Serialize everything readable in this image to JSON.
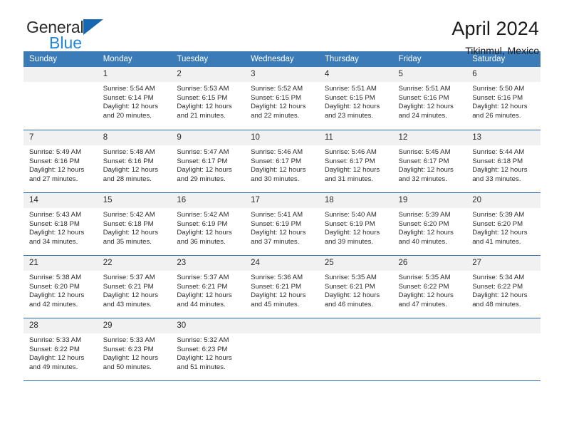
{
  "brand": {
    "name_part1": "General",
    "name_part2": "Blue",
    "triangle_color": "#1668b3",
    "blue_color": "#2287d8"
  },
  "header": {
    "title": "April 2024",
    "location": "Tikinmul, Mexico"
  },
  "theme": {
    "header_bg": "#3b7cb8",
    "daynum_bg": "#f1f1f1",
    "rule_color": "#2d6ca8",
    "text_color": "#2b2b2b"
  },
  "weekday_headers": [
    "Sunday",
    "Monday",
    "Tuesday",
    "Wednesday",
    "Thursday",
    "Friday",
    "Saturday"
  ],
  "labels": {
    "sunrise_prefix": "Sunrise: ",
    "sunset_prefix": "Sunset: ",
    "daylight_prefix": "Daylight: "
  },
  "weeks": [
    [
      {
        "day": "",
        "empty": true
      },
      {
        "day": "1",
        "sunrise": "Sunrise: 5:54 AM",
        "sunset": "Sunset: 6:14 PM",
        "daylight_l1": "Daylight: 12 hours",
        "daylight_l2": "and 20 minutes."
      },
      {
        "day": "2",
        "sunrise": "Sunrise: 5:53 AM",
        "sunset": "Sunset: 6:15 PM",
        "daylight_l1": "Daylight: 12 hours",
        "daylight_l2": "and 21 minutes."
      },
      {
        "day": "3",
        "sunrise": "Sunrise: 5:52 AM",
        "sunset": "Sunset: 6:15 PM",
        "daylight_l1": "Daylight: 12 hours",
        "daylight_l2": "and 22 minutes."
      },
      {
        "day": "4",
        "sunrise": "Sunrise: 5:51 AM",
        "sunset": "Sunset: 6:15 PM",
        "daylight_l1": "Daylight: 12 hours",
        "daylight_l2": "and 23 minutes."
      },
      {
        "day": "5",
        "sunrise": "Sunrise: 5:51 AM",
        "sunset": "Sunset: 6:16 PM",
        "daylight_l1": "Daylight: 12 hours",
        "daylight_l2": "and 24 minutes."
      },
      {
        "day": "6",
        "sunrise": "Sunrise: 5:50 AM",
        "sunset": "Sunset: 6:16 PM",
        "daylight_l1": "Daylight: 12 hours",
        "daylight_l2": "and 26 minutes."
      }
    ],
    [
      {
        "day": "7",
        "sunrise": "Sunrise: 5:49 AM",
        "sunset": "Sunset: 6:16 PM",
        "daylight_l1": "Daylight: 12 hours",
        "daylight_l2": "and 27 minutes."
      },
      {
        "day": "8",
        "sunrise": "Sunrise: 5:48 AM",
        "sunset": "Sunset: 6:16 PM",
        "daylight_l1": "Daylight: 12 hours",
        "daylight_l2": "and 28 minutes."
      },
      {
        "day": "9",
        "sunrise": "Sunrise: 5:47 AM",
        "sunset": "Sunset: 6:17 PM",
        "daylight_l1": "Daylight: 12 hours",
        "daylight_l2": "and 29 minutes."
      },
      {
        "day": "10",
        "sunrise": "Sunrise: 5:46 AM",
        "sunset": "Sunset: 6:17 PM",
        "daylight_l1": "Daylight: 12 hours",
        "daylight_l2": "and 30 minutes."
      },
      {
        "day": "11",
        "sunrise": "Sunrise: 5:46 AM",
        "sunset": "Sunset: 6:17 PM",
        "daylight_l1": "Daylight: 12 hours",
        "daylight_l2": "and 31 minutes."
      },
      {
        "day": "12",
        "sunrise": "Sunrise: 5:45 AM",
        "sunset": "Sunset: 6:17 PM",
        "daylight_l1": "Daylight: 12 hours",
        "daylight_l2": "and 32 minutes."
      },
      {
        "day": "13",
        "sunrise": "Sunrise: 5:44 AM",
        "sunset": "Sunset: 6:18 PM",
        "daylight_l1": "Daylight: 12 hours",
        "daylight_l2": "and 33 minutes."
      }
    ],
    [
      {
        "day": "14",
        "sunrise": "Sunrise: 5:43 AM",
        "sunset": "Sunset: 6:18 PM",
        "daylight_l1": "Daylight: 12 hours",
        "daylight_l2": "and 34 minutes."
      },
      {
        "day": "15",
        "sunrise": "Sunrise: 5:42 AM",
        "sunset": "Sunset: 6:18 PM",
        "daylight_l1": "Daylight: 12 hours",
        "daylight_l2": "and 35 minutes."
      },
      {
        "day": "16",
        "sunrise": "Sunrise: 5:42 AM",
        "sunset": "Sunset: 6:19 PM",
        "daylight_l1": "Daylight: 12 hours",
        "daylight_l2": "and 36 minutes."
      },
      {
        "day": "17",
        "sunrise": "Sunrise: 5:41 AM",
        "sunset": "Sunset: 6:19 PM",
        "daylight_l1": "Daylight: 12 hours",
        "daylight_l2": "and 37 minutes."
      },
      {
        "day": "18",
        "sunrise": "Sunrise: 5:40 AM",
        "sunset": "Sunset: 6:19 PM",
        "daylight_l1": "Daylight: 12 hours",
        "daylight_l2": "and 39 minutes."
      },
      {
        "day": "19",
        "sunrise": "Sunrise: 5:39 AM",
        "sunset": "Sunset: 6:20 PM",
        "daylight_l1": "Daylight: 12 hours",
        "daylight_l2": "and 40 minutes."
      },
      {
        "day": "20",
        "sunrise": "Sunrise: 5:39 AM",
        "sunset": "Sunset: 6:20 PM",
        "daylight_l1": "Daylight: 12 hours",
        "daylight_l2": "and 41 minutes."
      }
    ],
    [
      {
        "day": "21",
        "sunrise": "Sunrise: 5:38 AM",
        "sunset": "Sunset: 6:20 PM",
        "daylight_l1": "Daylight: 12 hours",
        "daylight_l2": "and 42 minutes."
      },
      {
        "day": "22",
        "sunrise": "Sunrise: 5:37 AM",
        "sunset": "Sunset: 6:21 PM",
        "daylight_l1": "Daylight: 12 hours",
        "daylight_l2": "and 43 minutes."
      },
      {
        "day": "23",
        "sunrise": "Sunrise: 5:37 AM",
        "sunset": "Sunset: 6:21 PM",
        "daylight_l1": "Daylight: 12 hours",
        "daylight_l2": "and 44 minutes."
      },
      {
        "day": "24",
        "sunrise": "Sunrise: 5:36 AM",
        "sunset": "Sunset: 6:21 PM",
        "daylight_l1": "Daylight: 12 hours",
        "daylight_l2": "and 45 minutes."
      },
      {
        "day": "25",
        "sunrise": "Sunrise: 5:35 AM",
        "sunset": "Sunset: 6:21 PM",
        "daylight_l1": "Daylight: 12 hours",
        "daylight_l2": "and 46 minutes."
      },
      {
        "day": "26",
        "sunrise": "Sunrise: 5:35 AM",
        "sunset": "Sunset: 6:22 PM",
        "daylight_l1": "Daylight: 12 hours",
        "daylight_l2": "and 47 minutes."
      },
      {
        "day": "27",
        "sunrise": "Sunrise: 5:34 AM",
        "sunset": "Sunset: 6:22 PM",
        "daylight_l1": "Daylight: 12 hours",
        "daylight_l2": "and 48 minutes."
      }
    ],
    [
      {
        "day": "28",
        "sunrise": "Sunrise: 5:33 AM",
        "sunset": "Sunset: 6:22 PM",
        "daylight_l1": "Daylight: 12 hours",
        "daylight_l2": "and 49 minutes."
      },
      {
        "day": "29",
        "sunrise": "Sunrise: 5:33 AM",
        "sunset": "Sunset: 6:23 PM",
        "daylight_l1": "Daylight: 12 hours",
        "daylight_l2": "and 50 minutes."
      },
      {
        "day": "30",
        "sunrise": "Sunrise: 5:32 AM",
        "sunset": "Sunset: 6:23 PM",
        "daylight_l1": "Daylight: 12 hours",
        "daylight_l2": "and 51 minutes."
      },
      {
        "day": "",
        "empty": true
      },
      {
        "day": "",
        "empty": true
      },
      {
        "day": "",
        "empty": true
      },
      {
        "day": "",
        "empty": true
      }
    ]
  ]
}
